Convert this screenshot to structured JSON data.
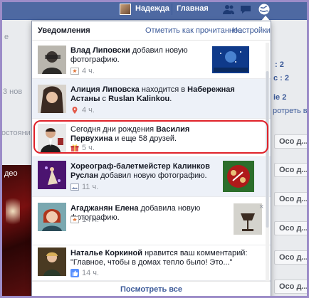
{
  "topbar": {
    "user_name": "Надежда",
    "home_label": "Главная",
    "icons": [
      "friend-requests-icon",
      "messages-icon",
      "notifications-globe-icon"
    ]
  },
  "background": {
    "left_texts": [
      "е",
      "3 нов",
      "остояни",
      "део"
    ],
    "right_texts": [
      ": 2",
      "с : 2",
      "ie 2",
      "ротреть все"
    ],
    "buttons": [
      "Осо д...",
      "Осо д...",
      "Осо д...",
      "Осо д...",
      "Осо д...",
      "Осо д..."
    ]
  },
  "panel": {
    "title": "Уведомления",
    "mark_read": "Отметить как прочитанное",
    "separator": "·",
    "settings": "Настройки",
    "see_all": "Посмотреть все",
    "items": [
      {
        "actor": "Влад Липовски",
        "text": " добавил новую фотографию.",
        "time": "4 ч.",
        "meta_icon": "photo-star-icon"
      },
      {
        "actor": "Алиция Липовска",
        "text": " находится в ",
        "place": "Набережная Астаны",
        "text2": " с ",
        "with": "Ruslan Kalinkou",
        "text3": ".",
        "time": "4 ч.",
        "meta_icon": "location-icon"
      },
      {
        "pre": "Сегодня дни рождения ",
        "actor": "Василия Первухина",
        "text": " и еще 58 друзей.",
        "time": "5 ч.",
        "meta_icon": "gift-icon"
      },
      {
        "actor": "Хореограф-балетмейстер Калинков Руслан",
        "text": " добавил новую фотографию.",
        "time": "11 ч.",
        "meta_icon": "photo-icon"
      },
      {
        "actor": "Агаджанян Елена",
        "text": " добавила новую фотографию.",
        "time": "14 ч.",
        "meta_icon": "photo-star-icon",
        "close": "×"
      },
      {
        "actor": "Наталье Коркиной",
        "text": " нравится ваш комментарий: \"Главное, чтобы в домах тепло было! Это...\"",
        "time": "14 ч.",
        "meta_icon": "like-icon"
      }
    ]
  },
  "colors": {
    "topbar": "#4e69a2",
    "link": "#3b5998",
    "unread_bg": "#edf1f8",
    "highlight_oval": "#e0222a",
    "frame": "#9c8cc8"
  }
}
